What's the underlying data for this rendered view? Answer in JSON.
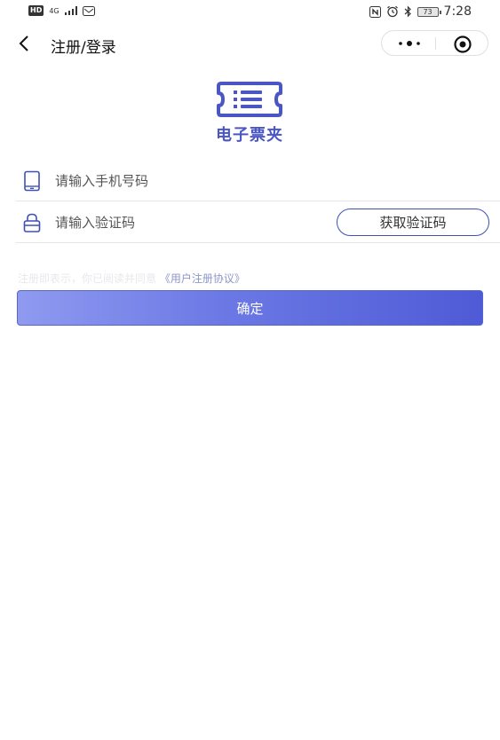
{
  "status_bar": {
    "hd": "HD",
    "network": "4G",
    "battery": "73",
    "time": "7:28"
  },
  "nav": {
    "title": "注册/登录"
  },
  "logo": {
    "text": "电子票夹"
  },
  "form": {
    "phone_placeholder": "请输入手机号码",
    "code_placeholder": "请输入验证码",
    "get_code_label": "获取验证码"
  },
  "agreement": {
    "text": "注册即表示，你已阅读并同意",
    "link": "《用户注册协议》"
  },
  "confirm": {
    "label": "确定"
  },
  "colors": {
    "brand": "#4a56c6",
    "button_gradient_start": "#8f9af0",
    "button_gradient_end": "#4f5bd6",
    "outline_button_border": "#3f51b5"
  },
  "icons": {
    "back": "back-arrow-icon",
    "more": "more-dots-icon",
    "close": "target-circle-icon",
    "phone": "phone-icon",
    "lock": "lock-icon",
    "logo": "ticket-list-icon"
  }
}
